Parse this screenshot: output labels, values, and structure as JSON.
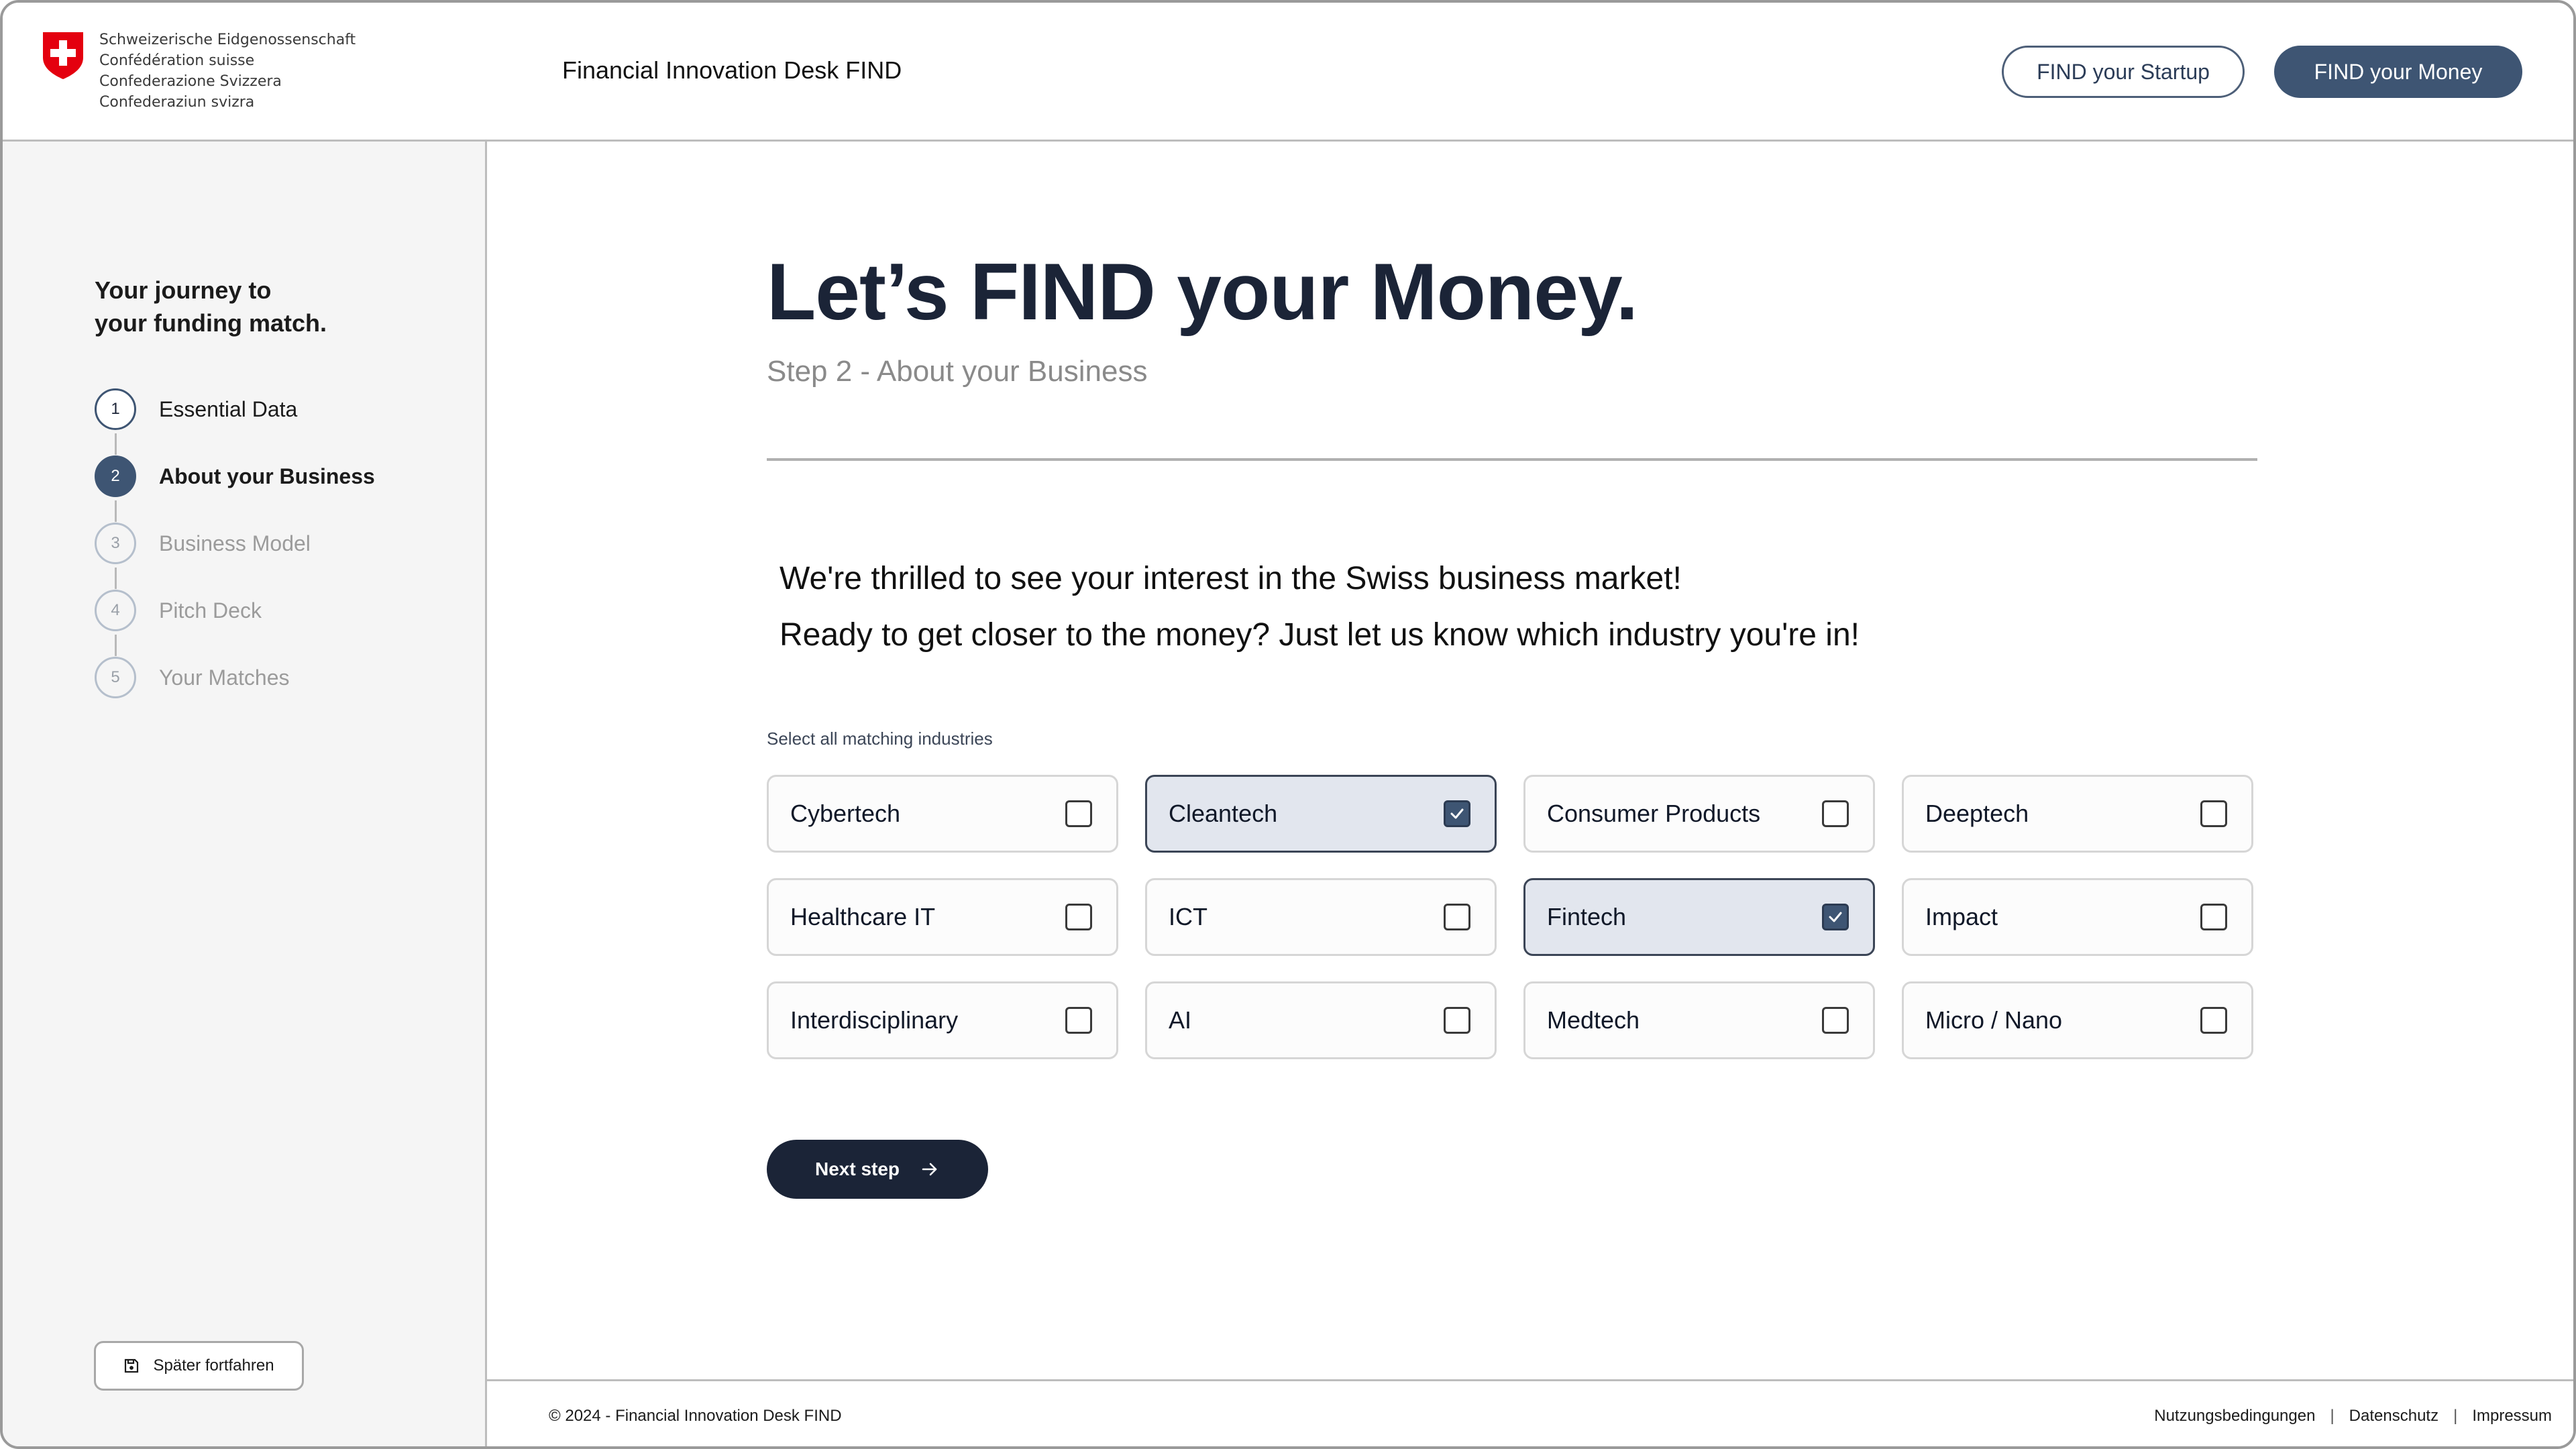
{
  "logo": {
    "icon": "swiss-shield-icon",
    "lines": [
      "Schweizerische Eidgenossenschaft",
      "Confédération suisse",
      "Confederazione Svizzera",
      "Confederaziun svizra"
    ]
  },
  "header": {
    "title": "Financial Innovation Desk FIND",
    "buttons": {
      "startup": "FIND your Startup",
      "money": "FIND your Money"
    }
  },
  "sidebar": {
    "journey_title_line1": "Your journey to",
    "journey_title_line2": "your funding match.",
    "steps": [
      {
        "number": "1",
        "label": "Essential Data",
        "state": "completed"
      },
      {
        "number": "2",
        "label": "About your Business",
        "state": "active"
      },
      {
        "number": "3",
        "label": "Business Model",
        "state": "pending"
      },
      {
        "number": "4",
        "label": "Pitch Deck",
        "state": "pending"
      },
      {
        "number": "5",
        "label": "Your Matches",
        "state": "pending"
      }
    ],
    "save_later": {
      "label": "Später fortfahren",
      "icon": "save-icon"
    }
  },
  "main": {
    "headline": "Let’s FIND your Money.",
    "subhead": "Step 2 - About your Business",
    "intro_line1": "We're thrilled to see your interest in the Swiss business market!",
    "intro_line2": "Ready to get closer to the money? Just let us know which industry you're in!",
    "select_label": "Select all matching industries",
    "industries": [
      {
        "label": "Cybertech",
        "checked": false
      },
      {
        "label": "Cleantech",
        "checked": true
      },
      {
        "label": "Consumer Products",
        "checked": false
      },
      {
        "label": "Deeptech",
        "checked": false
      },
      {
        "label": "Healthcare IT",
        "checked": false
      },
      {
        "label": "ICT",
        "checked": false
      },
      {
        "label": "Fintech",
        "checked": true
      },
      {
        "label": "Impact",
        "checked": false
      },
      {
        "label": "Interdisciplinary",
        "checked": false
      },
      {
        "label": "AI",
        "checked": false
      },
      {
        "label": "Medtech",
        "checked": false
      },
      {
        "label": "Micro / Nano",
        "checked": false
      }
    ],
    "next_button": {
      "label": "Next step",
      "icon": "arrow-right-icon"
    }
  },
  "footer": {
    "copyright": "© 2024 - Financial Innovation Desk FIND",
    "links": [
      "Nutzungsbedingungen",
      "Datenschutz",
      "Impressum"
    ],
    "separator": "|"
  },
  "colors": {
    "primary_dark": "#1b2437",
    "accent": "#3e5573",
    "selected_tile_bg": "#e2e6ee",
    "sidebar_bg": "#f5f5f5",
    "swiss_red": "#e4000f"
  }
}
